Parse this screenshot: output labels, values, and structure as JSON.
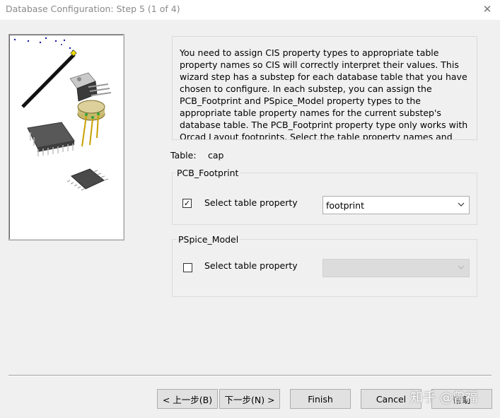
{
  "window": {
    "title": "Database Configuration: Step 5 (1 of 4)",
    "close_glyph": "✕"
  },
  "description": {
    "text": "You need to assign CIS property types to appropriate table property names so CIS will correctly interpret their values. This wizard step has a substep for each database table that you have chosen to configure. In each substep, you can assign the PCB_Footprint and PSpice_Model property types to the appropriate table property names for the current substep's database table. The PCB_Footprint property type only works with Orcad Layout footprints. Select the table property names and then click the Next button."
  },
  "table": {
    "label": "Table:",
    "value": "cap"
  },
  "pcb_footprint": {
    "legend": "PCB_Footprint",
    "checkbox_label": "Select table property",
    "checked": true,
    "check_glyph": "✓",
    "selected_value": "footprint"
  },
  "pspice_model": {
    "legend": "PSpice_Model",
    "checkbox_label": "Select table property",
    "checked": false,
    "selected_value": ""
  },
  "buttons": {
    "back": "< 上一步(B)",
    "next": "下一步(N) >",
    "finish": "Finish",
    "cancel": "Cancel",
    "help": "帮助"
  },
  "watermark": "知乎 @曾福",
  "colors": {
    "background": "#f0f0f0",
    "button_face": "#e1e1e1",
    "disabled_field": "#dcdcdc"
  }
}
